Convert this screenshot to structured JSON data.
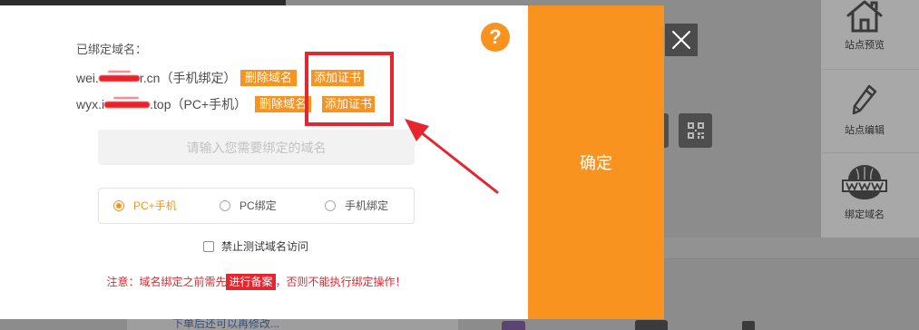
{
  "colors": {
    "accent_orange": "#F7931E",
    "alert_red": "#E5262E",
    "overlay_gray": "#8C8C8C"
  },
  "page": {
    "hint_text": "下单后还可以再修改..."
  },
  "qr_button": {
    "icon": "qr-code-icon"
  },
  "sidebar": {
    "items": [
      {
        "label": "站点预览",
        "icon": "house-icon"
      },
      {
        "label": "站点编辑",
        "icon": "pencil-icon"
      },
      {
        "label": "绑定域名",
        "icon": "www-globe-icon"
      }
    ]
  },
  "dialog": {
    "help_symbol": "?",
    "bound_title": "已绑定域名：",
    "domains": [
      {
        "prefix": "wei.",
        "suffix": "r.cn",
        "bind_type": "（手机绑定）",
        "delete_label": "删除域名",
        "cert_label": "添加证书"
      },
      {
        "prefix": "wyx.i",
        "suffix": ".top",
        "bind_type": "（PC+手机）",
        "delete_label": "删除域名",
        "cert_label": "添加证书"
      }
    ],
    "input": {
      "value": "",
      "placeholder": "请输入您需要绑定的域名"
    },
    "bind_options": [
      {
        "label": "PC+手机",
        "selected": true
      },
      {
        "label": "PC绑定",
        "selected": false
      },
      {
        "label": "手机绑定",
        "selected": false
      }
    ],
    "checkbox": {
      "label": "禁止测试域名访问",
      "checked": false
    },
    "notice": {
      "prefix": "注意：域名绑定之前需先",
      "link": "进行备案",
      "suffix": "，否则不能执行绑定操作！"
    },
    "confirm_label": "确定",
    "close_icon": "close-icon"
  }
}
